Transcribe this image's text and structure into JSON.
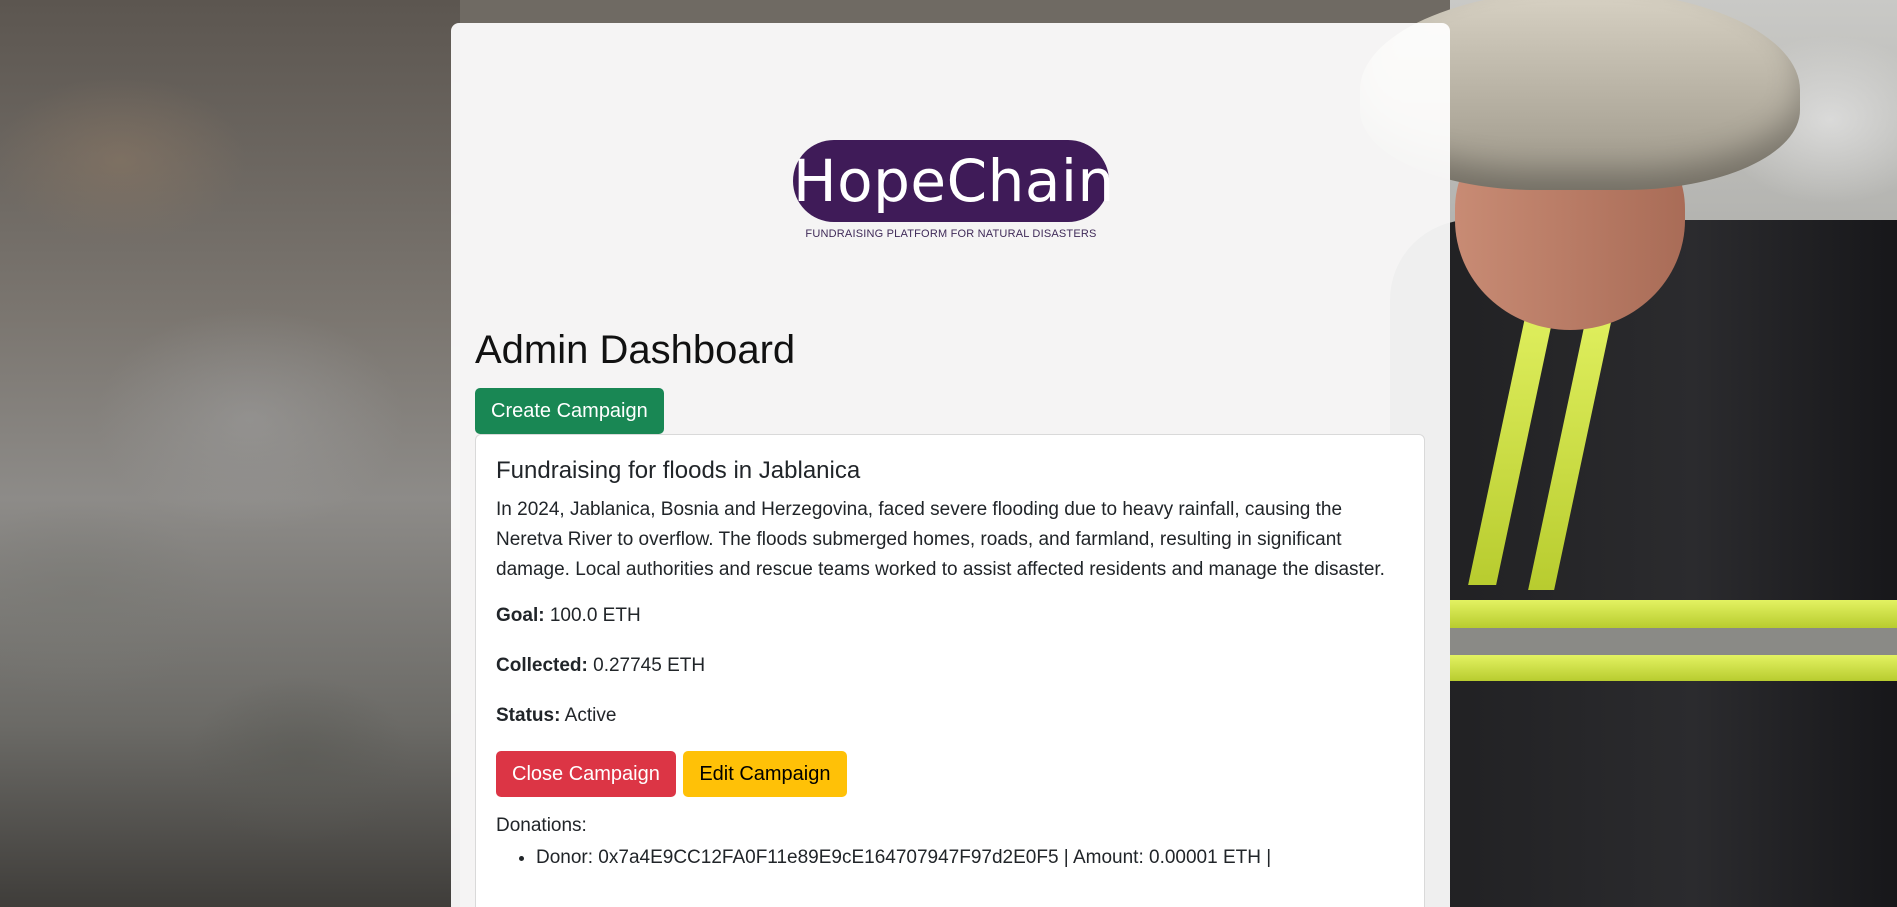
{
  "brand": {
    "name": "HopeChain",
    "tagline": "FUNDRAISING PLATFORM FOR NATURAL DISASTERS",
    "color": "#3f1b58"
  },
  "page": {
    "title": "Admin Dashboard",
    "create_button": "Create Campaign"
  },
  "campaign": {
    "title": "Fundraising for floods in Jablanica",
    "description": "In 2024, Jablanica, Bosnia and Herzegovina, faced severe flooding due to heavy rainfall, causing the Neretva River to overflow. The floods submerged homes, roads, and farmland, resulting in significant damage. Local authorities and rescue teams worked to assist affected residents and manage the disaster.",
    "goal_label": "Goal:",
    "goal_value": "100.0 ETH",
    "collected_label": "Collected:",
    "collected_value": "0.27745 ETH",
    "status_label": "Status:",
    "status_value": "Active",
    "close_button": "Close Campaign",
    "edit_button": "Edit Campaign",
    "donations_label": "Donations:",
    "donations": [
      "Donor: 0x7a4E9CC12FA0F11e89E9cE164707947F97d2E0F5 | Amount: 0.00001 ETH |"
    ]
  },
  "colors": {
    "create": "#198754",
    "close": "#dc3545",
    "edit": "#ffc107"
  }
}
